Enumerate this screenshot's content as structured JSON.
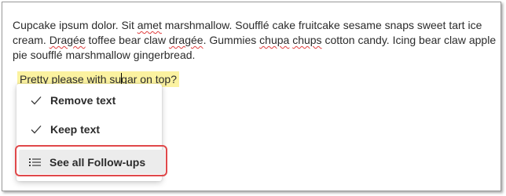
{
  "document": {
    "paragraph_parts": [
      "Cupcake ipsum dolor. Sit ",
      "amet",
      " marshmallow. Soufflé cake fruitcake sesame snaps sweet tart ice cream. ",
      "Dragée",
      " toffee bear claw ",
      "dragée",
      ". Gummies ",
      "chupa",
      " ",
      "chups",
      " cotton candy. Icing bear claw apple pie soufflé marshmallow gingerbread."
    ],
    "selected_text_before_caret": "Pretty please with su",
    "selected_text_after_caret": "gar on top?"
  },
  "menu": {
    "items": [
      {
        "label": "Remove text",
        "icon": "checkmark-icon"
      },
      {
        "label": "Keep text",
        "icon": "checkmark-icon"
      },
      {
        "label": "See all Follow-ups",
        "icon": "list-icon"
      }
    ]
  },
  "colors": {
    "highlight": "#fbf2a0",
    "callout": "#e0484a",
    "spelling_underline": "#e03c3c"
  }
}
